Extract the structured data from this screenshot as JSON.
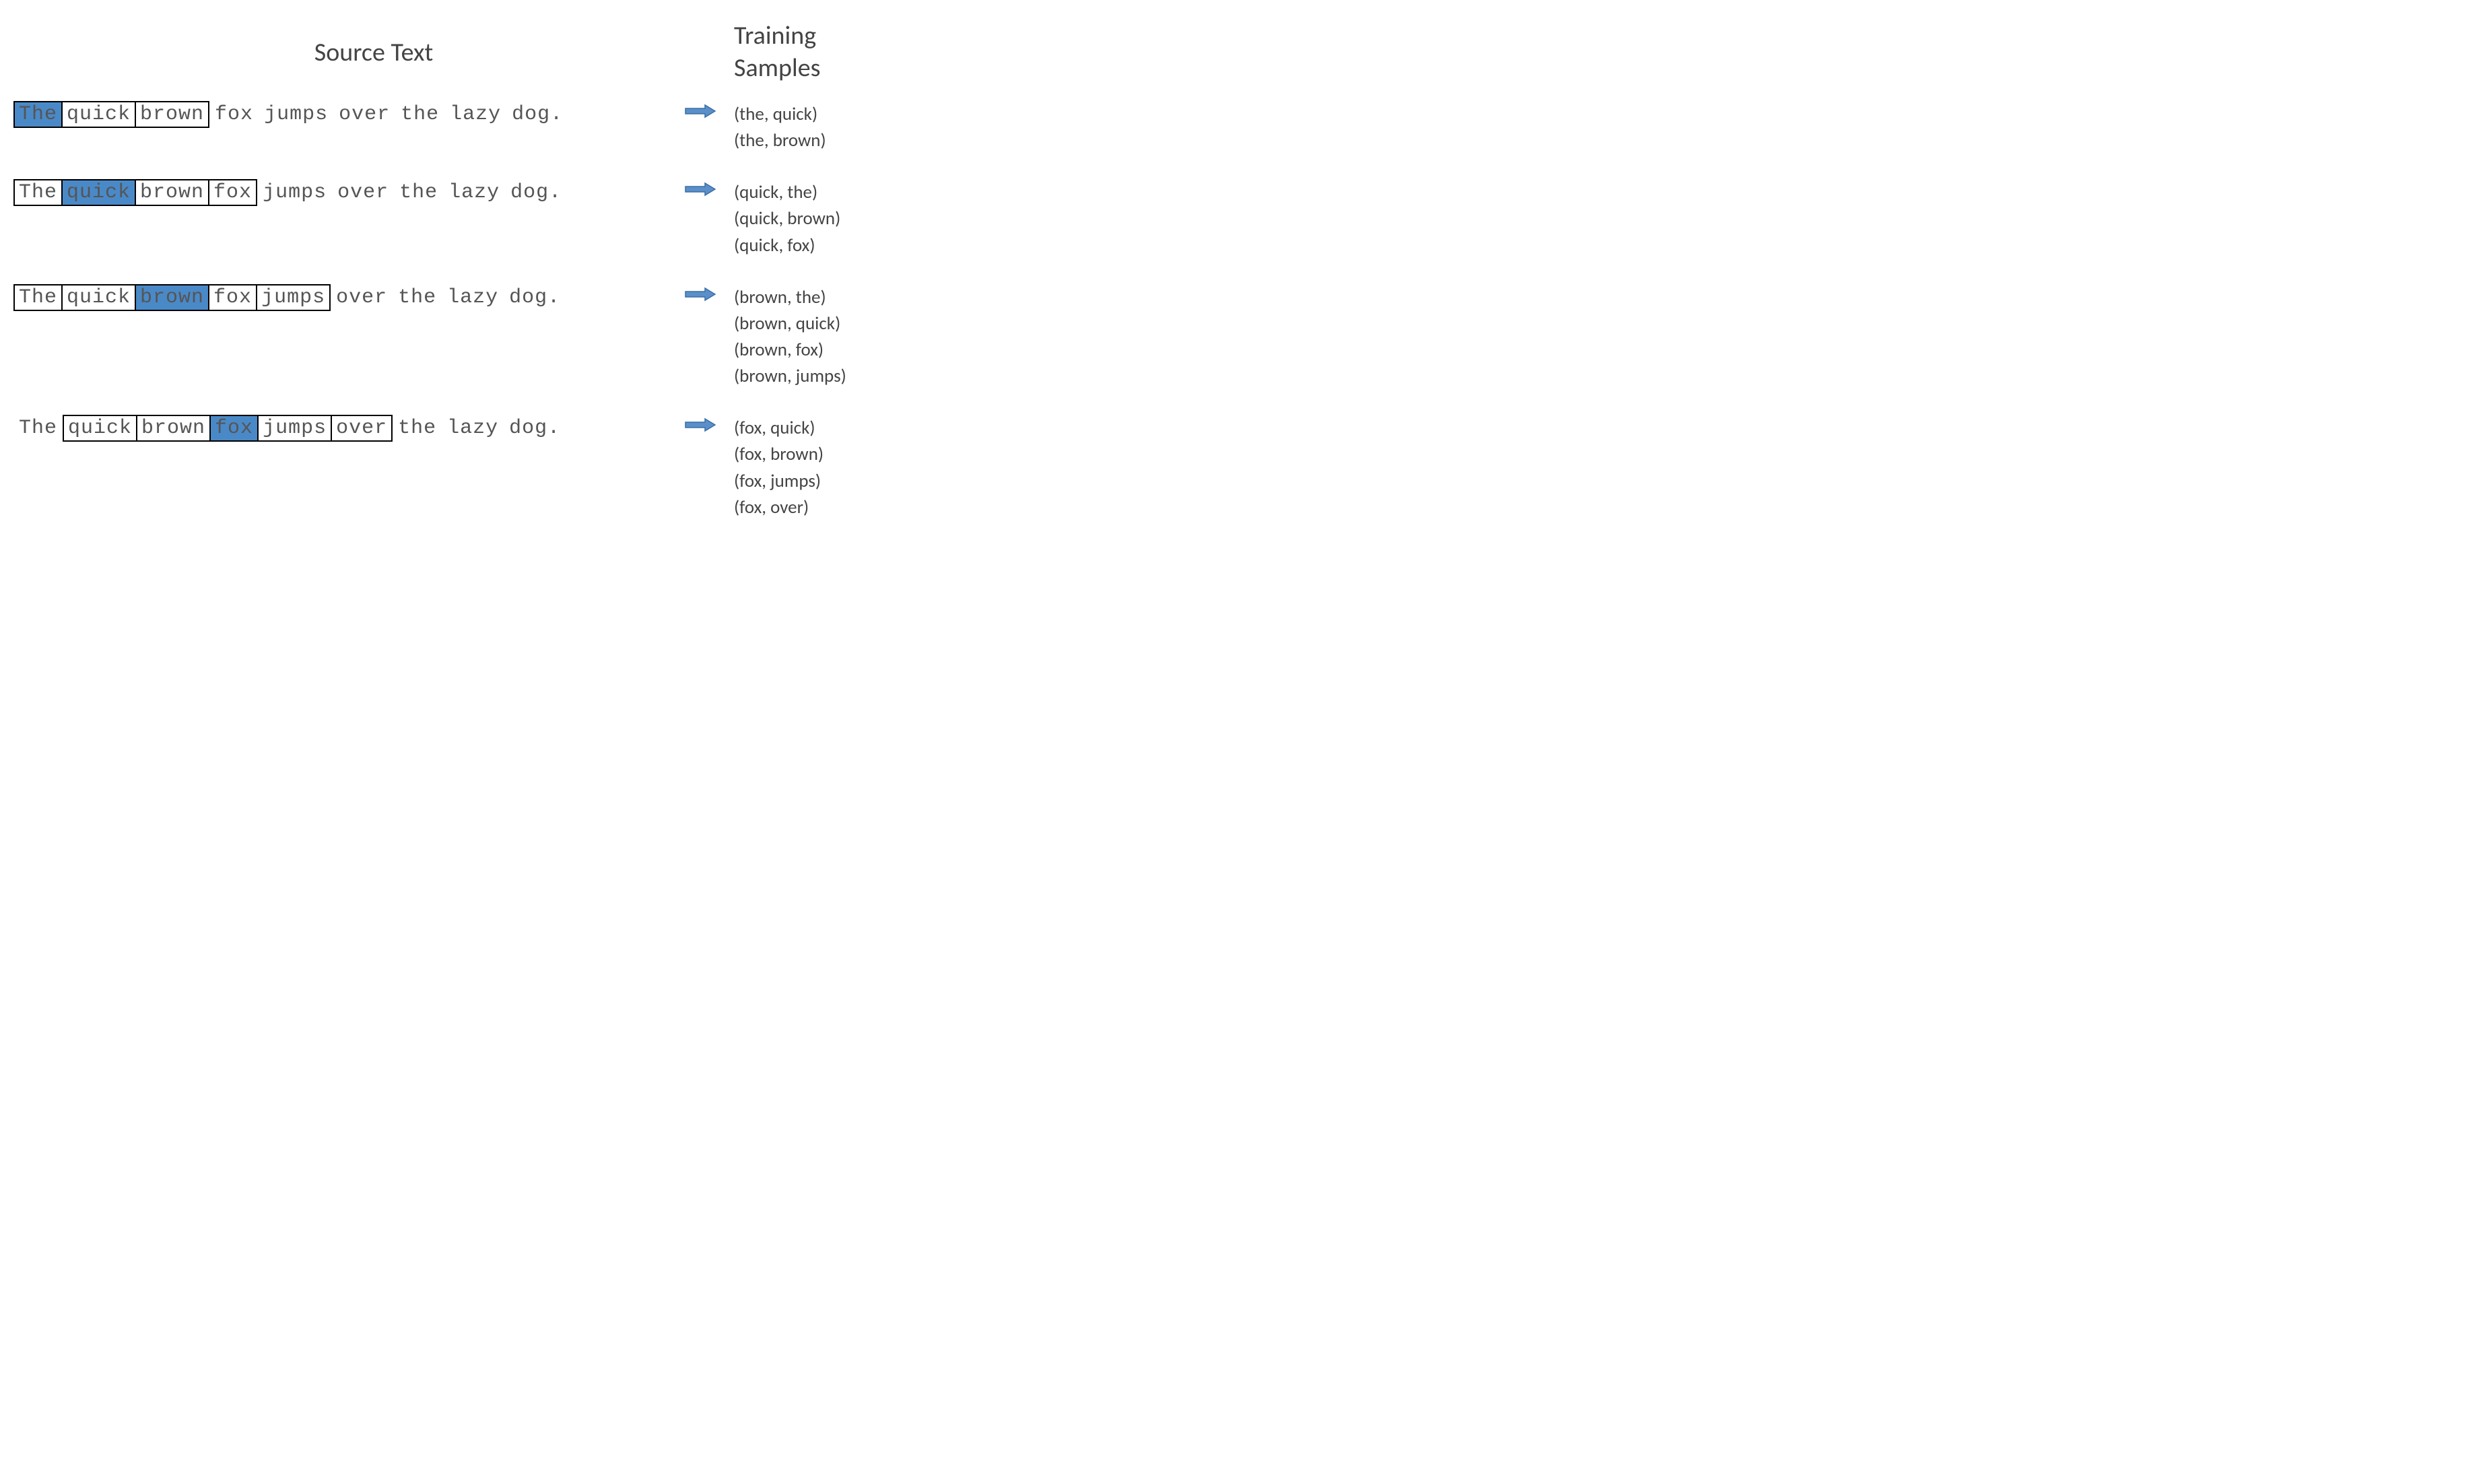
{
  "headers": {
    "left": "Source Text",
    "right_line1": "Training",
    "right_line2": "Samples"
  },
  "sentence": [
    "The",
    "quick",
    "brown",
    "fox",
    "jumps",
    "over",
    "the",
    "lazy",
    "dog."
  ],
  "rows": [
    {
      "target_index": 0,
      "window_start": 0,
      "window_end": 2,
      "samples": [
        "(the, quick)",
        "(the, brown)"
      ]
    },
    {
      "target_index": 1,
      "window_start": 0,
      "window_end": 3,
      "samples": [
        "(quick, the)",
        "(quick, brown)",
        "(quick, fox)"
      ]
    },
    {
      "target_index": 2,
      "window_start": 0,
      "window_end": 4,
      "samples": [
        "(brown, the)",
        "(brown, quick)",
        "(brown, fox)",
        "(brown, jumps)"
      ]
    },
    {
      "target_index": 3,
      "window_start": 1,
      "window_end": 5,
      "samples": [
        "(fox, quick)",
        "(fox, brown)",
        "(fox, jumps)",
        "(fox, over)"
      ]
    }
  ],
  "colors": {
    "highlight": "#4a89c7",
    "arrow_fill": "#5a8fc9",
    "arrow_stroke": "#3b6fa5"
  }
}
